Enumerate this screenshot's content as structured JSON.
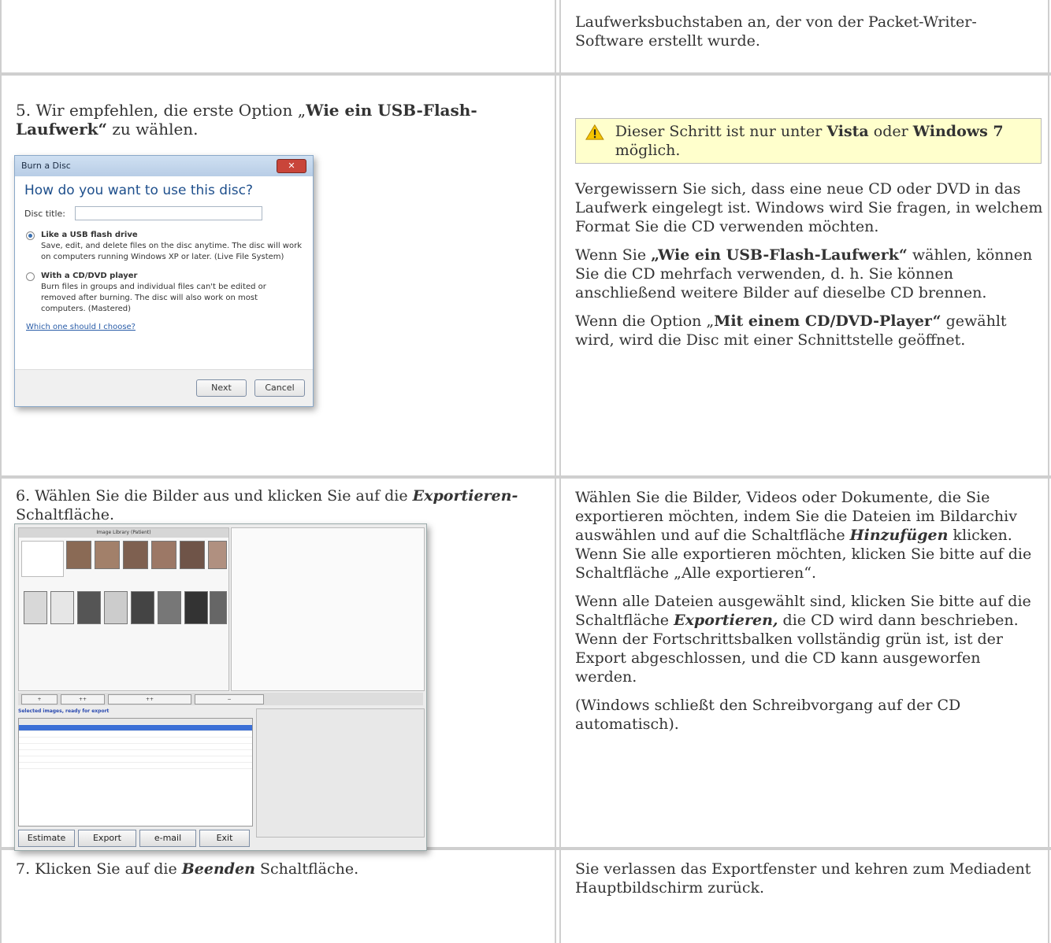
{
  "row_top": {
    "right_text": "Laufwerksbuchstaben an, der von der Packet-Writer-Software erstellt wurde."
  },
  "row5": {
    "left_prefix": "5. Wir empfehlen, die erste Option „",
    "left_bold": "Wie ein USB-Flash-Laufwerk“",
    "left_suffix": " zu wählen.",
    "warning_prefix": "Dieser Schritt ist nur unter ",
    "warning_bold1": "Vista",
    "warning_mid": " oder ",
    "warning_bold2": "Windows 7",
    "warning_suffix": " möglich.",
    "p1": "Vergewissern Sie sich, dass eine neue CD oder DVD in das Laufwerk eingelegt ist. Windows wird Sie fragen, in welchem Format Sie die CD verwenden möchten.",
    "p2_prefix": "Wenn Sie ",
    "p2_bold": "„Wie ein USB-Flash-Laufwerk“",
    "p2_suffix": " wählen, können Sie die CD mehrfach verwenden, d. h. Sie können anschließend weitere Bilder auf dieselbe CD brennen.",
    "p3_prefix": "Wenn die Option „",
    "p3_bold": "Mit einem CD/DVD-Player“",
    "p3_suffix": " gewählt wird, wird die Disc mit einer Schnittstelle geöffnet."
  },
  "dialog": {
    "title": "Burn a Disc",
    "question": "How do you want to use this disc?",
    "disc_title_label": "Disc title:",
    "opt1_title": "Like a USB flash drive",
    "opt1_desc": "Save, edit, and delete files on the disc anytime. The disc will work on computers running Windows XP or later. (Live File System)",
    "opt2_title": "With a CD/DVD player",
    "opt2_desc": "Burn files in groups and individual files can't be edited or removed after burning. The disc will also work on most computers. (Mastered)",
    "link": "Which one should I choose?",
    "next": "Next",
    "cancel": "Cancel"
  },
  "row6": {
    "left_prefix": "6. Wählen Sie die Bilder aus und klicken Sie auf die ",
    "left_bold": "Exportieren-",
    "left_suffix": " Schaltfläche.",
    "p1_prefix": "Wählen Sie die Bilder, Videos oder Dokumente, die Sie exportieren möchten, indem Sie die Dateien im Bildarchiv auswählen und auf die Schaltfläche ",
    "p1_bold": "Hinzufügen",
    "p1_suffix": " klicken. Wenn Sie alle exportieren möchten, klicken Sie bitte auf die Schaltfläche „Alle exportieren“.",
    "p2_prefix": "Wenn alle Dateien ausgewählt sind, klicken Sie bitte auf die Schaltfläche ",
    "p2_bold": "Exportieren,",
    "p2_suffix": " die CD wird dann beschrieben. Wenn der Fortschrittsbalken vollständig grün ist, ist der Export abgeschlossen, und die CD kann ausgeworfen werden.",
    "p3": "(Windows schließt den Schreibvorgang auf der CD automatisch)."
  },
  "export_window": {
    "library_title": "Image Library (Patient)",
    "selected_header": "Selected images, ready for export",
    "estimate": "Estimate",
    "export": "Export",
    "email": "e-mail",
    "exit": "Exit"
  },
  "row7": {
    "left_prefix": "7. Klicken Sie auf die ",
    "left_bold": "Beenden",
    "left_suffix": " Schaltfläche.",
    "right_text": " Sie verlassen das Exportfenster und kehren zum Mediadent Hauptbildschirm zurück."
  }
}
